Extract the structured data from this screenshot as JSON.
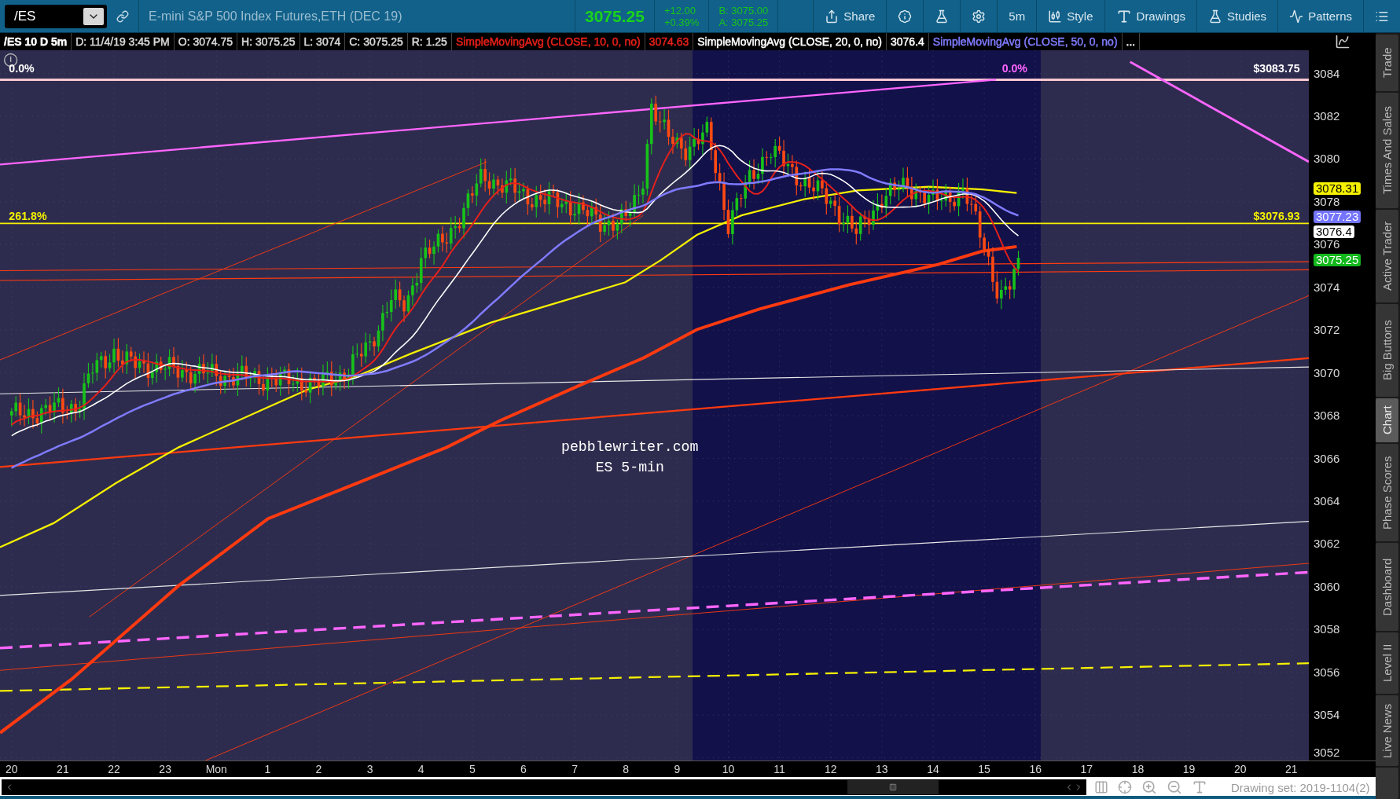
{
  "toolbar": {
    "symbol": "/ES",
    "description": "E-mini S&P 500 Index Futures,ETH (DEC 19)",
    "last_price": "3075.25",
    "change": "+12.00",
    "change_percent": "+0.39%",
    "bid": "B: 3075.00",
    "ask": "A: 3075.25",
    "buttons": [
      {
        "kind": "share",
        "label": "Share"
      },
      {
        "kind": "info"
      },
      {
        "kind": "flask"
      },
      {
        "kind": "settings"
      },
      {
        "kind": "interval",
        "label": "5m"
      },
      {
        "kind": "style",
        "label": "Style"
      },
      {
        "kind": "drawings",
        "label": "Drawings"
      },
      {
        "kind": "studies",
        "label": "Studies"
      },
      {
        "kind": "patterns",
        "label": "Patterns"
      },
      {
        "kind": "menu"
      }
    ]
  },
  "info_bar": {
    "title": "/ES 10 D 5m",
    "fields": [
      "D: 11/4/19 3:45 PM",
      "O: 3074.75",
      "H: 3075.25",
      "L: 3074",
      "C: 3075.25",
      "R: 1.25"
    ],
    "studies": [
      {
        "label": "SimpleMovingAvg (CLOSE, 10, 0, no)",
        "value": "3074.63",
        "color": "#e8201a"
      },
      {
        "label": "SimpleMovingAvg (CLOSE, 20, 0, no)",
        "value": "3076.4",
        "color": "#ffffff"
      },
      {
        "label": "SimpleMovingAvg (CLOSE, 50, 0, no)",
        "color": "#7f7bff"
      }
    ],
    "more": "..."
  },
  "chart": {
    "labels": [
      {
        "text": "0.0%",
        "color": "#ffffff"
      },
      {
        "text": "0.0%",
        "color": "#ff66ff"
      },
      {
        "text": "$3083.75",
        "color": "#ffffff"
      },
      {
        "text": "261.8%",
        "color": "#f5f000"
      },
      {
        "text": "$3076.93",
        "color": "#f5f000"
      }
    ],
    "note": [
      "pebblewriter.com",
      "ES 5-min"
    ]
  },
  "price_axis": {
    "ticks": [
      "3084",
      "3082",
      "3080",
      "3078",
      "3076",
      "3074",
      "3072",
      "3070",
      "3068",
      "3066",
      "3064",
      "3062",
      "3060",
      "3058",
      "3056",
      "3054",
      "3052"
    ],
    "badges": [
      {
        "value": "3078.31",
        "color": "#f5f000"
      },
      {
        "value": "3077.23",
        "color": "#7474ff"
      },
      {
        "value": "3076.4",
        "color": "#ffffff"
      },
      {
        "value": "3075.25",
        "color": "#13b81d"
      }
    ]
  },
  "time_axis": {
    "labels": [
      "20",
      "21",
      "22",
      "23",
      "Mon",
      "1",
      "2",
      "3",
      "4",
      "5",
      "6",
      "7",
      "8",
      "9",
      "10",
      "11",
      "12",
      "13",
      "14",
      "15",
      "16",
      "17",
      "18",
      "19",
      "20",
      "21"
    ]
  },
  "status_bar": {
    "drawing_set": "Drawing set: 2019-1104(2)"
  },
  "side_tabs": [
    {
      "label": "Trade",
      "selected": false
    },
    {
      "label": "Times And Sales",
      "selected": false
    },
    {
      "label": "Active Trader",
      "selected": false
    },
    {
      "label": "Big Buttons",
      "selected": false
    },
    {
      "label": "Chart",
      "selected": true
    },
    {
      "label": "Phase Scores",
      "selected": false
    },
    {
      "label": "Dashboard",
      "selected": false
    },
    {
      "label": "Level II",
      "selected": false
    },
    {
      "label": "Live News",
      "selected": false
    }
  ]
}
